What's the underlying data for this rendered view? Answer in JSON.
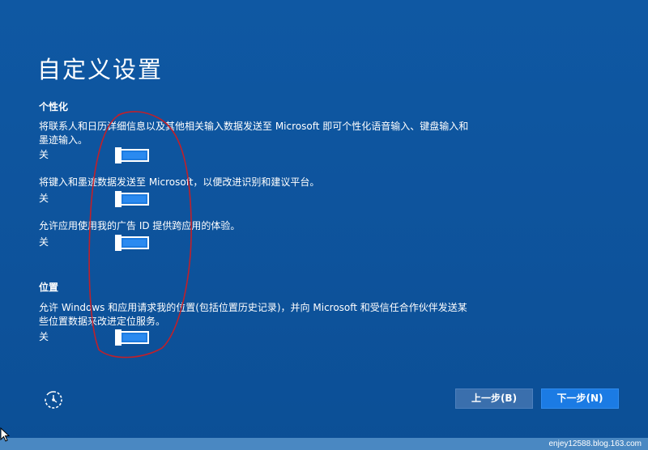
{
  "title": "自定义设置",
  "sections": [
    {
      "heading": "个性化",
      "settings": [
        {
          "description": "将联系人和日历详细信息以及其他相关输入数据发送至 Microsoft 即可个性化语音输入、键盘输入和墨迹输入。",
          "state_label": "关",
          "on": false
        },
        {
          "description": "将键入和墨迹数据发送至 Microsoft，以便改进识别和建议平台。",
          "state_label": "关",
          "on": false
        },
        {
          "description": "允许应用使用我的广告 ID 提供跨应用的体验。",
          "state_label": "关",
          "on": false
        }
      ]
    },
    {
      "heading": "位置",
      "settings": [
        {
          "description": "允许 Windows 和应用请求我的位置(包括位置历史记录)，并向 Microsoft 和受信任合作伙伴发送某些位置数据来改进定位服务。",
          "state_label": "关",
          "on": false
        }
      ]
    }
  ],
  "buttons": {
    "back_label": "上一步(B)",
    "next_label": "下一步(N)"
  },
  "icons": {
    "restore": "ease-of-access-icon",
    "cursor": "mouse-pointer-icon"
  },
  "colors": {
    "background": "#0e56a0",
    "toggle_fill": "#1d7be0",
    "next_button": "#1b7be4",
    "back_button": "#3a6fad",
    "annotation": "#c0202a"
  },
  "watermark": "enjey12588.blog.163.com"
}
